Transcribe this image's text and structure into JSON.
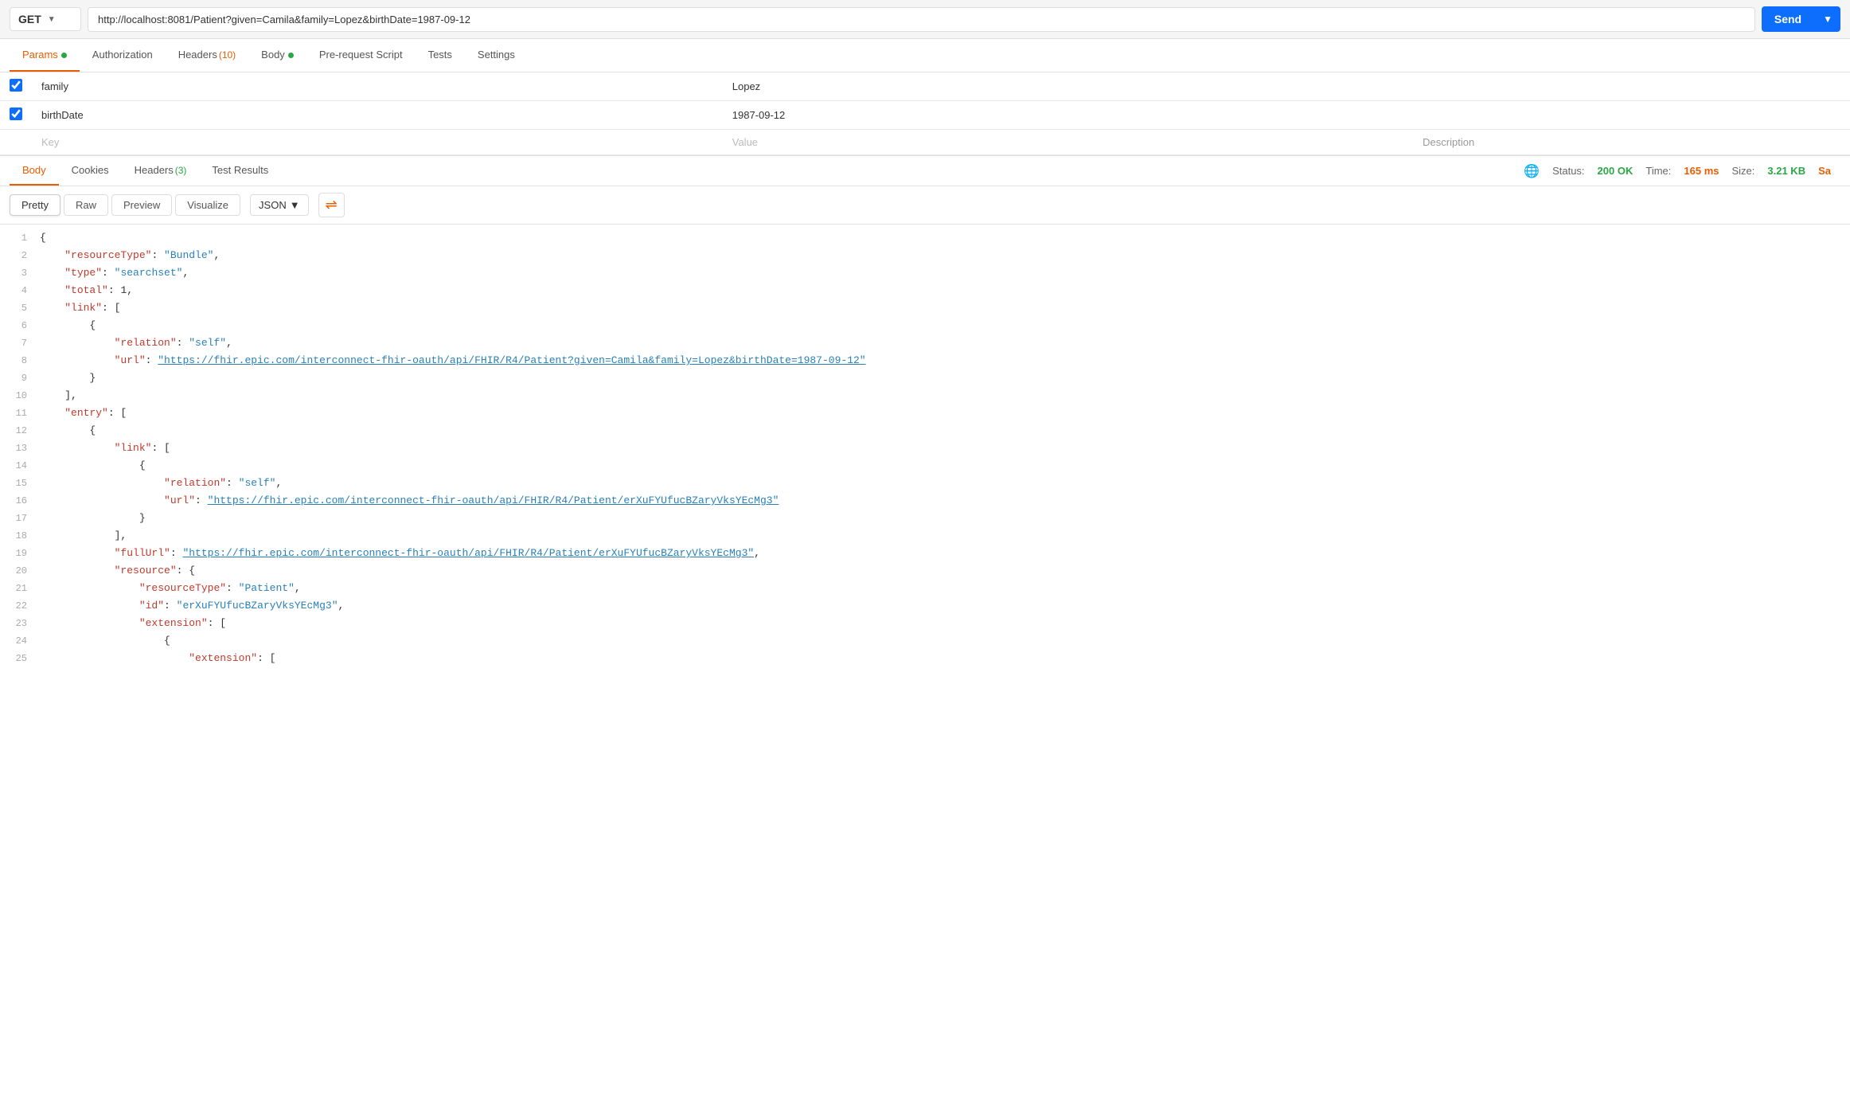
{
  "urlBar": {
    "method": "GET",
    "url": "http://localhost:8081/Patient?given=Camila&family=Lopez&birthDate=1987-09-12",
    "sendLabel": "Send"
  },
  "requestTabs": [
    {
      "id": "params",
      "label": "Params",
      "dot": true,
      "badge": null,
      "active": true
    },
    {
      "id": "authorization",
      "label": "Authorization",
      "dot": false,
      "badge": null,
      "active": false
    },
    {
      "id": "headers",
      "label": "Headers",
      "dot": false,
      "badge": "(10)",
      "active": false
    },
    {
      "id": "body",
      "label": "Body",
      "dot": true,
      "badge": null,
      "active": false
    },
    {
      "id": "prerequest",
      "label": "Pre-request Script",
      "dot": false,
      "badge": null,
      "active": false
    },
    {
      "id": "tests",
      "label": "Tests",
      "dot": false,
      "badge": null,
      "active": false
    },
    {
      "id": "settings",
      "label": "Settings",
      "dot": false,
      "badge": null,
      "active": false
    }
  ],
  "paramsTable": {
    "columns": [
      "",
      "Key",
      "Value",
      "Description"
    ],
    "rows": [
      {
        "checked": true,
        "key": "family",
        "value": "Lopez",
        "description": ""
      },
      {
        "checked": true,
        "key": "birthDate",
        "value": "1987-09-12",
        "description": ""
      }
    ],
    "placeholder": {
      "key": "Key",
      "value": "Value",
      "description": "Description"
    }
  },
  "responseTabs": [
    {
      "id": "body",
      "label": "Body",
      "badge": null,
      "active": true
    },
    {
      "id": "cookies",
      "label": "Cookies",
      "badge": null,
      "active": false
    },
    {
      "id": "headers",
      "label": "Headers",
      "badge": "(3)",
      "active": false
    },
    {
      "id": "testresults",
      "label": "Test Results",
      "badge": null,
      "active": false
    }
  ],
  "statusBar": {
    "statusLabel": "Status:",
    "statusValue": "200 OK",
    "timeLabel": "Time:",
    "timeValue": "165 ms",
    "sizeLabel": "Size:",
    "sizeValue": "3.21 KB",
    "saveLabel": "Sa"
  },
  "formatBar": {
    "tabs": [
      "Pretty",
      "Raw",
      "Preview",
      "Visualize"
    ],
    "activeTab": "Pretty",
    "format": "JSON"
  },
  "codeLines": [
    {
      "num": 1,
      "tokens": [
        {
          "type": "brace",
          "text": "{"
        }
      ]
    },
    {
      "num": 2,
      "tokens": [
        {
          "type": "indent",
          "text": "    "
        },
        {
          "type": "key",
          "text": "\"resourceType\""
        },
        {
          "type": "plain",
          "text": ": "
        },
        {
          "type": "str",
          "text": "\"Bundle\""
        },
        {
          "type": "plain",
          "text": ","
        }
      ]
    },
    {
      "num": 3,
      "tokens": [
        {
          "type": "indent",
          "text": "    "
        },
        {
          "type": "key",
          "text": "\"type\""
        },
        {
          "type": "plain",
          "text": ": "
        },
        {
          "type": "str",
          "text": "\"searchset\""
        },
        {
          "type": "plain",
          "text": ","
        }
      ]
    },
    {
      "num": 4,
      "tokens": [
        {
          "type": "indent",
          "text": "    "
        },
        {
          "type": "key",
          "text": "\"total\""
        },
        {
          "type": "plain",
          "text": ": "
        },
        {
          "type": "num",
          "text": "1"
        },
        {
          "type": "plain",
          "text": ","
        }
      ]
    },
    {
      "num": 5,
      "tokens": [
        {
          "type": "indent",
          "text": "    "
        },
        {
          "type": "key",
          "text": "\"link\""
        },
        {
          "type": "plain",
          "text": ": ["
        }
      ]
    },
    {
      "num": 6,
      "tokens": [
        {
          "type": "indent",
          "text": "        "
        },
        {
          "type": "brace",
          "text": "{"
        }
      ]
    },
    {
      "num": 7,
      "tokens": [
        {
          "type": "indent",
          "text": "            "
        },
        {
          "type": "key",
          "text": "\"relation\""
        },
        {
          "type": "plain",
          "text": ": "
        },
        {
          "type": "str",
          "text": "\"self\""
        },
        {
          "type": "plain",
          "text": ","
        }
      ]
    },
    {
      "num": 8,
      "tokens": [
        {
          "type": "indent",
          "text": "            "
        },
        {
          "type": "key",
          "text": "\"url\""
        },
        {
          "type": "plain",
          "text": ": "
        },
        {
          "type": "link",
          "text": "\"https://fhir.epic.com/interconnect-fhir-oauth/api/FHIR/R4/Patient?given=Camila&family=Lopez&birthDate=1987-09-12\""
        }
      ]
    },
    {
      "num": 9,
      "tokens": [
        {
          "type": "indent",
          "text": "        "
        },
        {
          "type": "brace",
          "text": "}"
        }
      ]
    },
    {
      "num": 10,
      "tokens": [
        {
          "type": "indent",
          "text": "    "
        },
        {
          "type": "plain",
          "text": "],"
        }
      ]
    },
    {
      "num": 11,
      "tokens": [
        {
          "type": "indent",
          "text": "    "
        },
        {
          "type": "key",
          "text": "\"entry\""
        },
        {
          "type": "plain",
          "text": ": ["
        }
      ]
    },
    {
      "num": 12,
      "tokens": [
        {
          "type": "indent",
          "text": "        "
        },
        {
          "type": "brace",
          "text": "{"
        }
      ]
    },
    {
      "num": 13,
      "tokens": [
        {
          "type": "indent",
          "text": "            "
        },
        {
          "type": "key",
          "text": "\"link\""
        },
        {
          "type": "plain",
          "text": ": ["
        }
      ]
    },
    {
      "num": 14,
      "tokens": [
        {
          "type": "indent",
          "text": "                "
        },
        {
          "type": "brace",
          "text": "{"
        }
      ]
    },
    {
      "num": 15,
      "tokens": [
        {
          "type": "indent",
          "text": "                    "
        },
        {
          "type": "key",
          "text": "\"relation\""
        },
        {
          "type": "plain",
          "text": ": "
        },
        {
          "type": "str",
          "text": "\"self\""
        },
        {
          "type": "plain",
          "text": ","
        }
      ]
    },
    {
      "num": 16,
      "tokens": [
        {
          "type": "indent",
          "text": "                    "
        },
        {
          "type": "key",
          "text": "\"url\""
        },
        {
          "type": "plain",
          "text": ": "
        },
        {
          "type": "link",
          "text": "\"https://fhir.epic.com/interconnect-fhir-oauth/api/FHIR/R4/Patient/erXuFYUfucBZaryVksYEcMg3\""
        }
      ]
    },
    {
      "num": 17,
      "tokens": [
        {
          "type": "indent",
          "text": "                "
        },
        {
          "type": "brace",
          "text": "}"
        }
      ]
    },
    {
      "num": 18,
      "tokens": [
        {
          "type": "indent",
          "text": "            "
        },
        {
          "type": "plain",
          "text": "],"
        }
      ]
    },
    {
      "num": 19,
      "tokens": [
        {
          "type": "indent",
          "text": "            "
        },
        {
          "type": "key",
          "text": "\"fullUrl\""
        },
        {
          "type": "plain",
          "text": ": "
        },
        {
          "type": "link",
          "text": "\"https://fhir.epic.com/interconnect-fhir-oauth/api/FHIR/R4/Patient/erXuFYUfucBZaryVksYEcMg3\""
        },
        {
          "type": "plain",
          "text": ","
        }
      ]
    },
    {
      "num": 20,
      "tokens": [
        {
          "type": "indent",
          "text": "            "
        },
        {
          "type": "key",
          "text": "\"resource\""
        },
        {
          "type": "plain",
          "text": ": {"
        }
      ]
    },
    {
      "num": 21,
      "tokens": [
        {
          "type": "indent",
          "text": "                "
        },
        {
          "type": "key",
          "text": "\"resourceType\""
        },
        {
          "type": "plain",
          "text": ": "
        },
        {
          "type": "str",
          "text": "\"Patient\""
        },
        {
          "type": "plain",
          "text": ","
        }
      ]
    },
    {
      "num": 22,
      "tokens": [
        {
          "type": "indent",
          "text": "                "
        },
        {
          "type": "key",
          "text": "\"id\""
        },
        {
          "type": "plain",
          "text": ": "
        },
        {
          "type": "str",
          "text": "\"erXuFYUfucBZaryVksYEcMg3\""
        },
        {
          "type": "plain",
          "text": ","
        }
      ]
    },
    {
      "num": 23,
      "tokens": [
        {
          "type": "indent",
          "text": "                "
        },
        {
          "type": "key",
          "text": "\"extension\""
        },
        {
          "type": "plain",
          "text": ": ["
        }
      ]
    },
    {
      "num": 24,
      "tokens": [
        {
          "type": "indent",
          "text": "                    "
        },
        {
          "type": "brace",
          "text": "{"
        }
      ]
    },
    {
      "num": 25,
      "tokens": [
        {
          "type": "indent",
          "text": "                        "
        },
        {
          "type": "key",
          "text": "\"extension\""
        },
        {
          "type": "plain",
          "text": ": ["
        }
      ]
    }
  ]
}
